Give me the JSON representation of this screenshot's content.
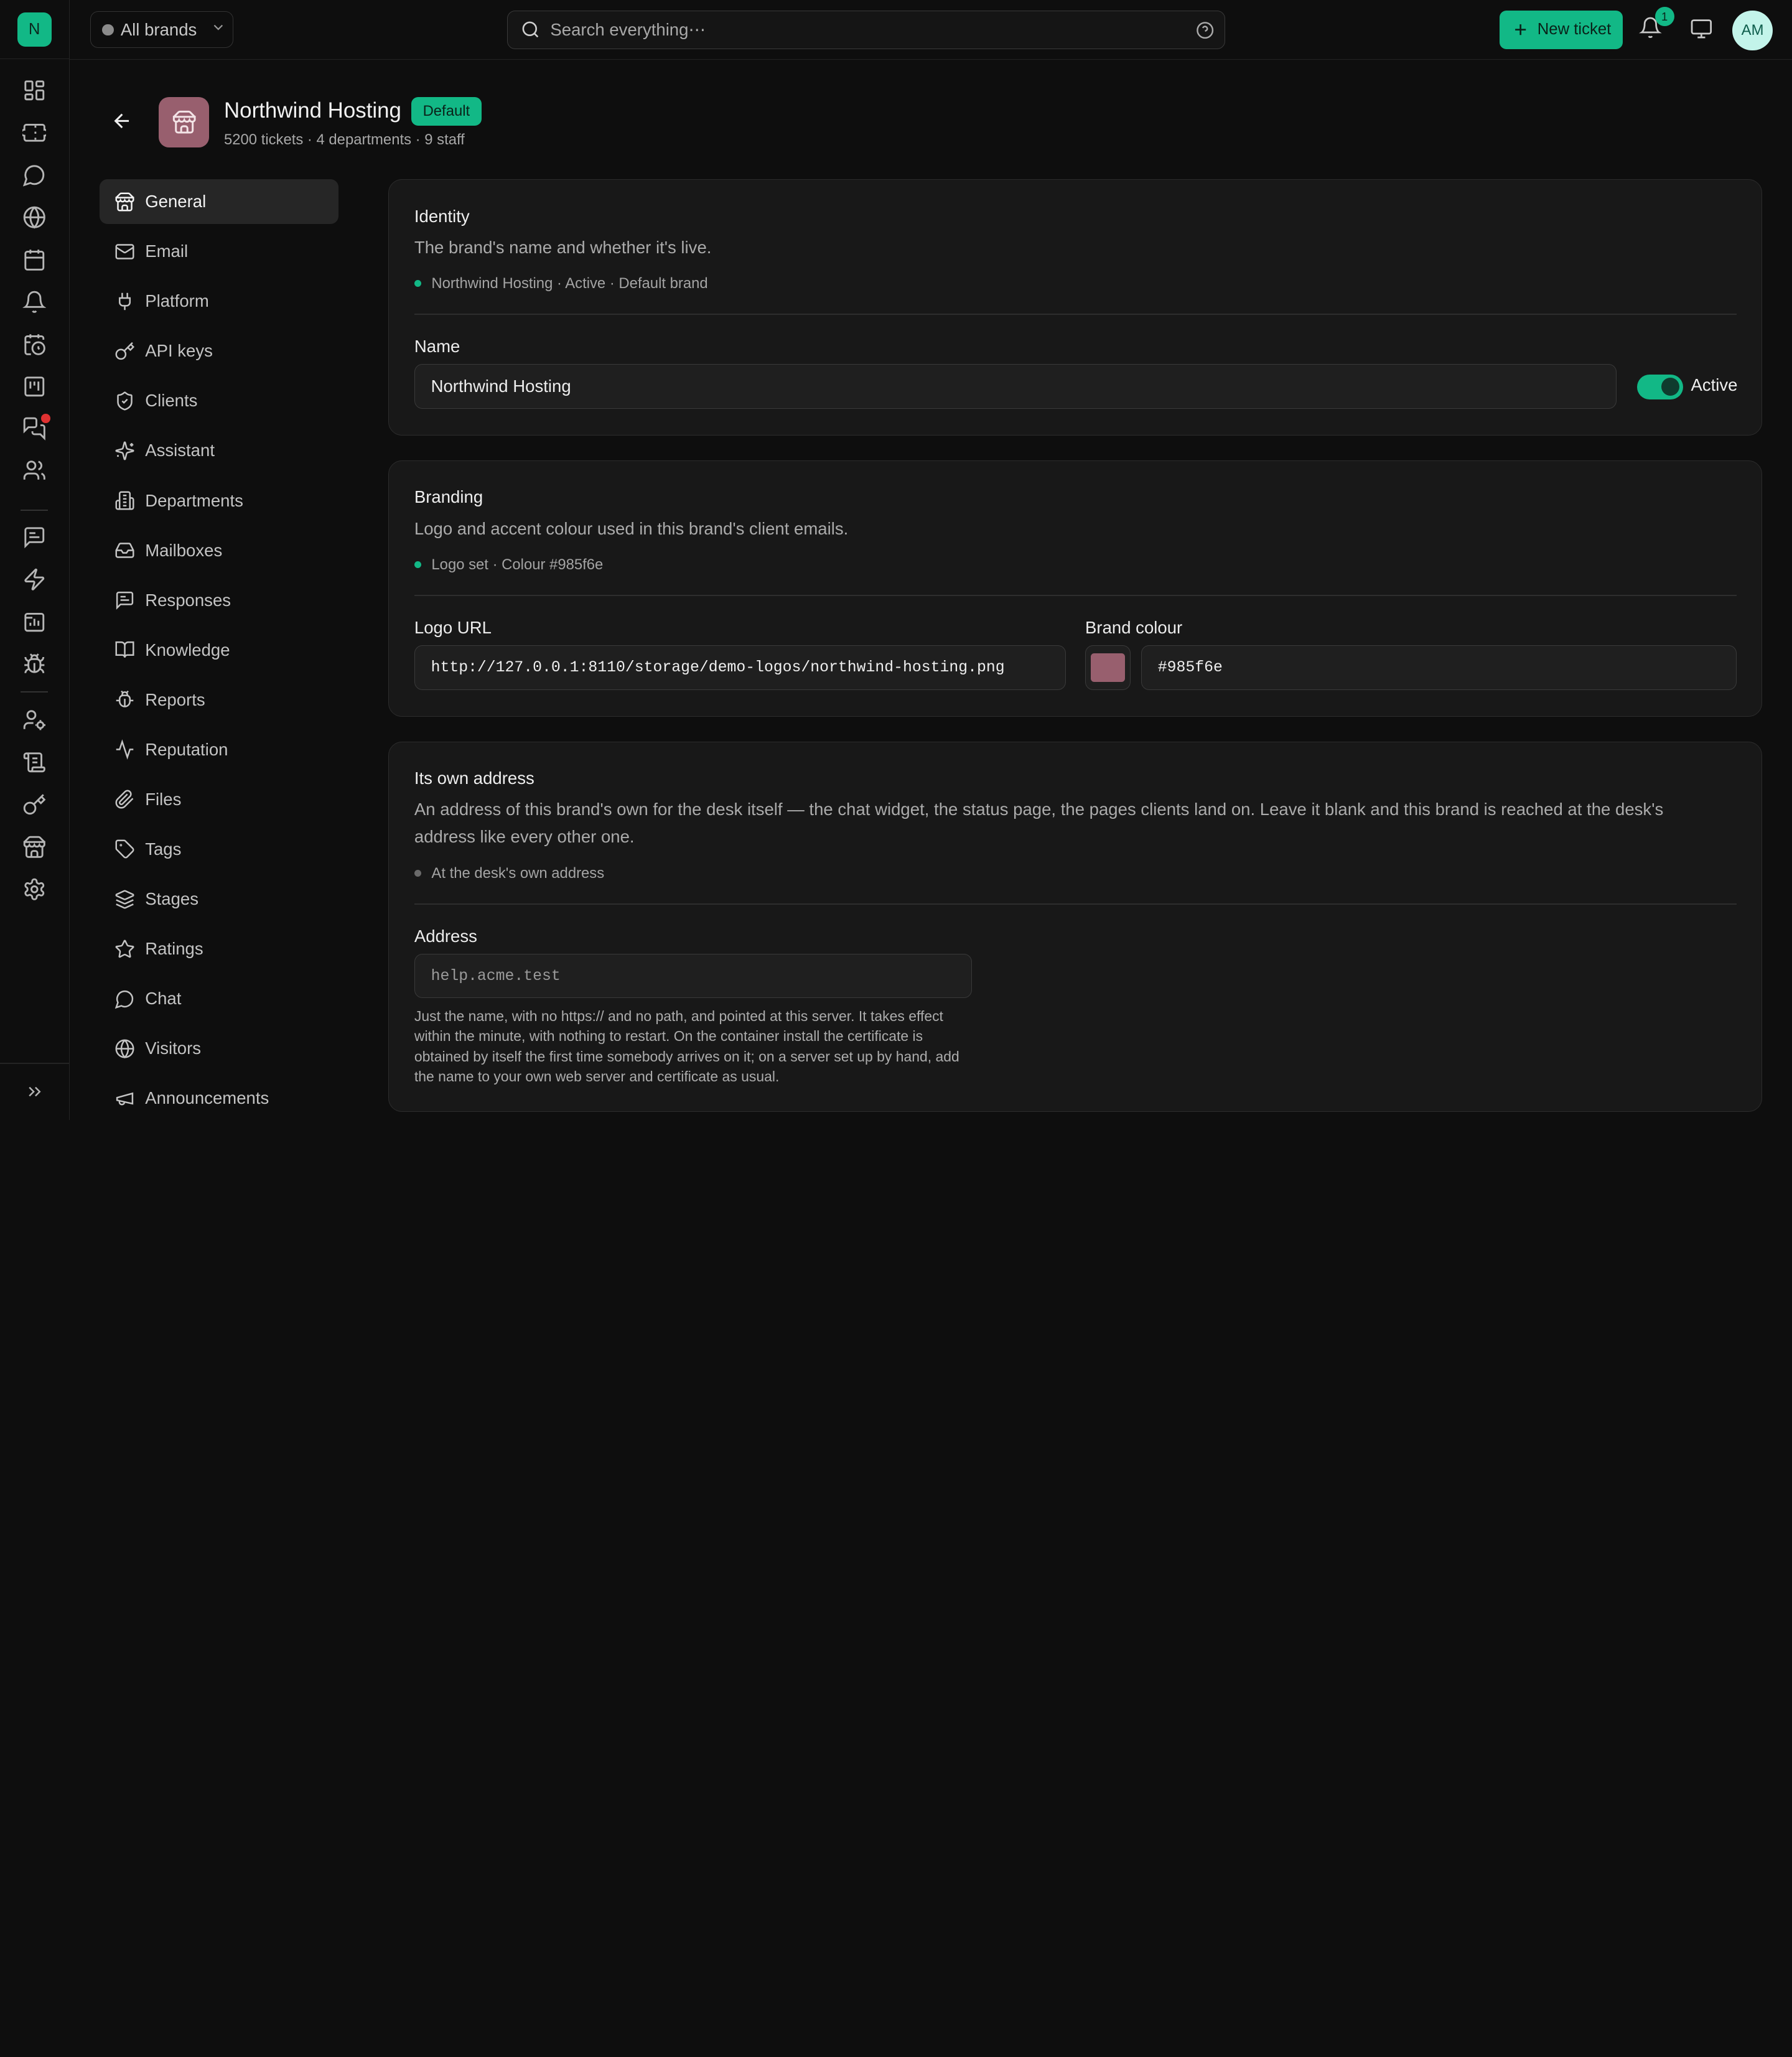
{
  "rail": {
    "logo_letter": "N",
    "items": [
      {
        "icon": "dashboard-icon"
      },
      {
        "icon": "ticket-icon"
      },
      {
        "icon": "chat-bubble-icon"
      },
      {
        "icon": "globe-icon"
      },
      {
        "icon": "calendar-icon"
      },
      {
        "icon": "bell-icon"
      },
      {
        "icon": "calendar-clock-icon"
      },
      {
        "icon": "kanban-icon"
      },
      {
        "icon": "messages-icon"
      },
      {
        "icon": "users-icon"
      },
      {
        "icon": "message-square-text-icon"
      },
      {
        "icon": "zap-icon"
      },
      {
        "icon": "folder-chart-icon"
      },
      {
        "icon": "bug-icon"
      },
      {
        "icon": "user-cog-icon"
      },
      {
        "icon": "scroll-icon"
      },
      {
        "icon": "key-icon"
      },
      {
        "icon": "store-icon"
      },
      {
        "icon": "settings-icon"
      }
    ],
    "expand_icon": "chevrons-right-icon"
  },
  "topbar": {
    "brand_filter": "All brands",
    "search_placeholder": "Search everything⋯",
    "new_ticket_label": "New ticket",
    "notification_count": "1",
    "avatar_initials": "AM"
  },
  "header": {
    "title": "Northwind Hosting",
    "badge": "Default",
    "subtitle": "5200 tickets · 4 departments · 9 staff"
  },
  "nav": {
    "items": [
      {
        "label": "General",
        "icon": "store-icon",
        "active": true
      },
      {
        "label": "Email",
        "icon": "mail-icon"
      },
      {
        "label": "Platform",
        "icon": "plug-icon"
      },
      {
        "label": "API keys",
        "icon": "key-icon"
      },
      {
        "label": "Clients",
        "icon": "shield-check-icon"
      },
      {
        "label": "Assistant",
        "icon": "sparkles-icon"
      },
      {
        "label": "Departments",
        "icon": "building-icon"
      },
      {
        "label": "Mailboxes",
        "icon": "inbox-icon"
      },
      {
        "label": "Responses",
        "icon": "message-square-text-icon"
      },
      {
        "label": "Knowledge",
        "icon": "book-open-icon"
      },
      {
        "label": "Reports",
        "icon": "bug-icon"
      },
      {
        "label": "Reputation",
        "icon": "activity-icon"
      },
      {
        "label": "Files",
        "icon": "paperclip-icon"
      },
      {
        "label": "Tags",
        "icon": "tag-icon"
      },
      {
        "label": "Stages",
        "icon": "layers-icon"
      },
      {
        "label": "Ratings",
        "icon": "star-icon"
      },
      {
        "label": "Chat",
        "icon": "chat-bubble-icon"
      },
      {
        "label": "Visitors",
        "icon": "globe-icon"
      },
      {
        "label": "Announcements",
        "icon": "megaphone-icon"
      }
    ]
  },
  "identity": {
    "title": "Identity",
    "description": "The brand's name and whether it's live.",
    "status": "Northwind Hosting · Active · Default brand",
    "name_label": "Name",
    "name_value": "Northwind Hosting",
    "active_label": "Active",
    "active": true
  },
  "branding": {
    "title": "Branding",
    "description": "Logo and accent colour used in this brand's client emails.",
    "status": "Logo set · Colour #985f6e",
    "logo_label": "Logo URL",
    "logo_value": "http://127.0.0.1:8110/storage/demo-logos/northwind-hosting.png",
    "colour_label": "Brand colour",
    "colour_value": "#985f6e"
  },
  "address": {
    "title": "Its own address",
    "description": "An address of this brand's own for the desk itself — the chat widget, the status page, the pages clients land on. Leave it blank and this brand is reached at the desk's address like every other one.",
    "status": "At the desk's own address",
    "field_label": "Address",
    "placeholder": "help.acme.test",
    "hint": "Just the name, with no https:// and no path, and pointed at this server. It takes effect within the minute, with nothing to restart. On the container install the certificate is obtained by itself the first time somebody arrives on it; on a server set up by hand, add the name to your own web server and certificate as usual."
  },
  "colors": {
    "accent": "#12b886",
    "brand": "#985f6e",
    "background": "#0e0e0e",
    "card": "#181818",
    "alert_dot": "#e03131"
  }
}
